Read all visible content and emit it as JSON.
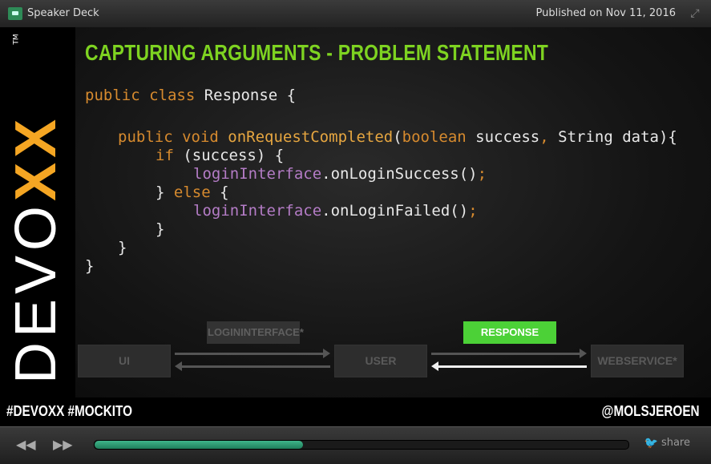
{
  "topbar": {
    "app_name": "Speaker Deck",
    "published": "Published on Nov 11, 2016",
    "expand_icon": "expand-icon"
  },
  "slide": {
    "brand": {
      "letters": [
        "D",
        "E",
        "V",
        "O"
      ],
      "x1": "X",
      "x2": "X",
      "tm": "TM"
    },
    "title": "CAPTURING ARGUMENTS - PROBLEM STATEMENT",
    "code": {
      "l1": {
        "a": "public class",
        "b": " Response {"
      },
      "l2": {
        "a": "public void",
        "b": " ",
        "c": "onRequestCompleted",
        "d": "(",
        "e": "boolean",
        "f": " success",
        "g": ",",
        "h": " String data){"
      },
      "l3": {
        "a": "if",
        "b": " (success) {"
      },
      "l4": {
        "a": "loginInterface",
        "b": ".onLoginSuccess()",
        "c": ";"
      },
      "l5": {
        "a": "} ",
        "b": "else",
        "c": " {"
      },
      "l6": {
        "a": "loginInterface",
        "b": ".onLoginFailed()",
        "c": ";"
      },
      "l7": "}",
      "l8": "}",
      "l9": "}"
    },
    "diagram": {
      "label_interface": "LOGININTERFACE*",
      "label_response": "RESPONSE",
      "box_ui": "UI",
      "box_user": "USER",
      "box_webservice": "WEBSERVICE*"
    },
    "footer": {
      "hashtags": "#DEVOXX  #MOCKITO",
      "handle": "@MOLSJEROEN"
    }
  },
  "controls": {
    "rewind_icon": "rewind-icon",
    "forward_icon": "fast-forward-icon",
    "progress": 0.39,
    "share_label": "share",
    "twitter_icon": "twitter-bird-icon"
  }
}
